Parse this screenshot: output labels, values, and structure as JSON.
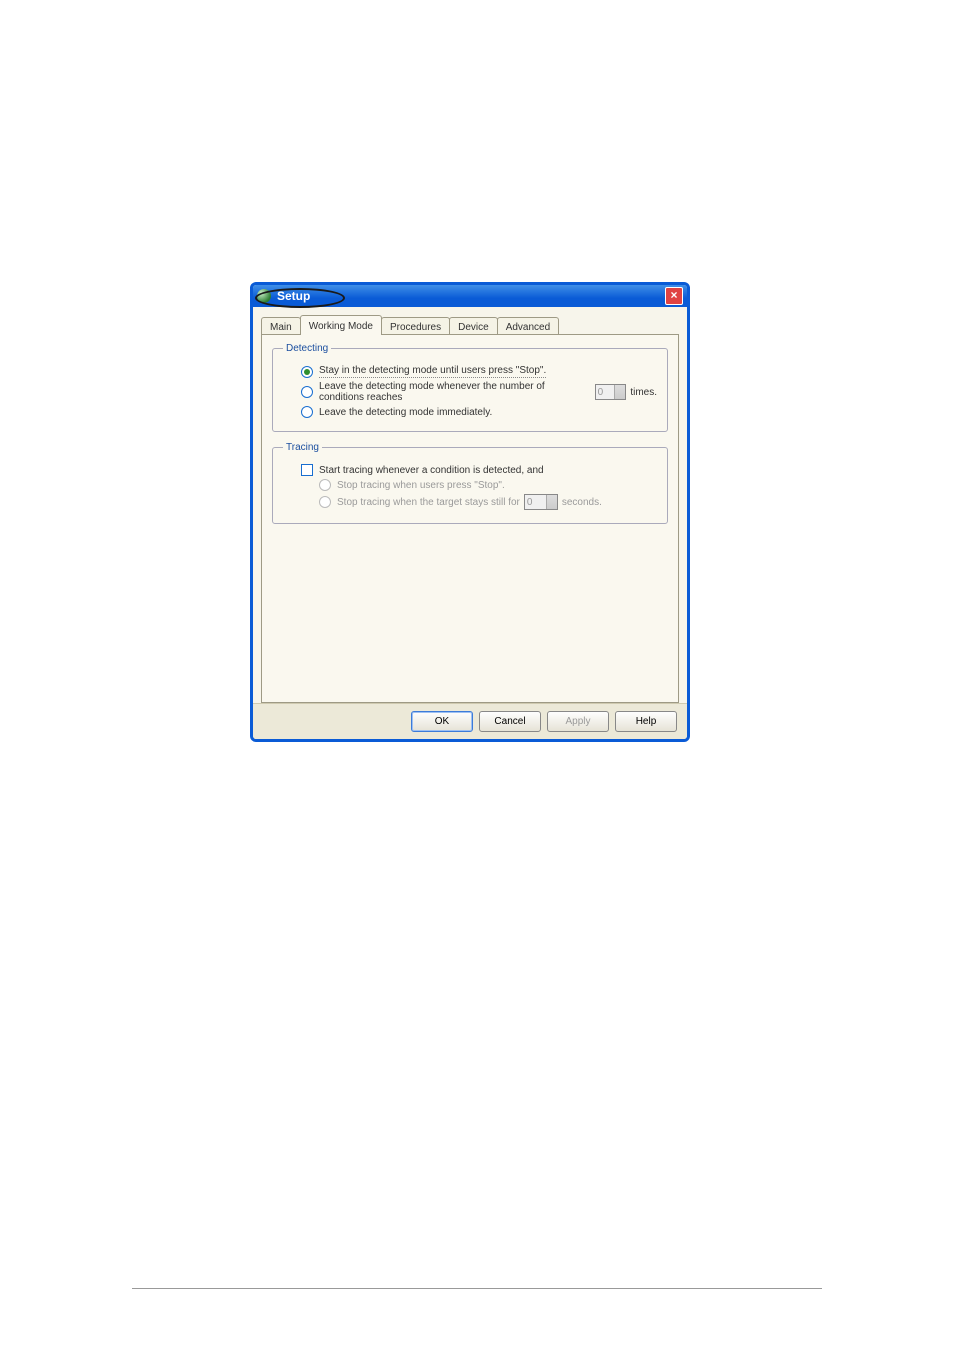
{
  "window": {
    "title": "Setup"
  },
  "tabs": [
    {
      "label": "Main"
    },
    {
      "label": "Working Mode"
    },
    {
      "label": "Procedures"
    },
    {
      "label": "Device"
    },
    {
      "label": "Advanced"
    }
  ],
  "detecting": {
    "legend": "Detecting",
    "opt_stay": "Stay in the detecting mode until users press \"Stop\".",
    "opt_leave_count_pre": "Leave the detecting mode whenever the number of conditions reaches",
    "opt_leave_count_value": "0",
    "opt_leave_count_post": "times.",
    "opt_leave_immediately": "Leave the detecting mode immediately."
  },
  "tracing": {
    "legend": "Tracing",
    "chk_start": "Start tracing whenever a condition is detected,  and",
    "opt_stop_users": "Stop tracing when users press \"Stop\".",
    "opt_stop_still_pre": "Stop tracing when the target stays still for",
    "opt_stop_still_value": "0",
    "opt_stop_still_post": "seconds."
  },
  "buttons": {
    "ok": "OK",
    "cancel": "Cancel",
    "apply": "Apply",
    "help": "Help"
  }
}
